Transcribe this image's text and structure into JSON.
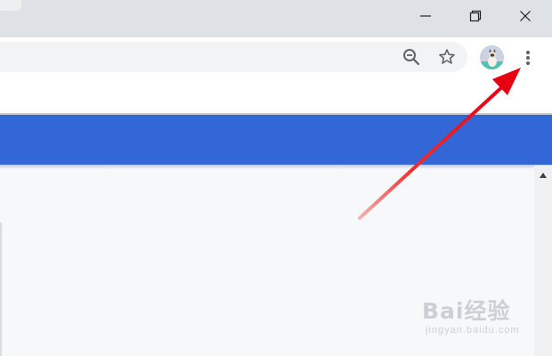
{
  "window_controls": {
    "minimize_icon": "minimize-icon",
    "restore_icon": "restore-icon",
    "close_icon": "close-icon"
  },
  "toolbar": {
    "zoom_icon": "zoom-out-icon",
    "bookmark_icon": "star-icon",
    "profile_icon": "avatar",
    "menu_icon": "kebab-menu-icon"
  },
  "page": {
    "banner_color": "#3366d6",
    "scroll_up_icon": "triangle-up-icon"
  },
  "annotation": {
    "arrow_color": "#e60012",
    "points_to": "kebab-menu-icon"
  },
  "watermark": {
    "logo_text": "Bai经验",
    "url": "jingyan.baidu.com"
  }
}
